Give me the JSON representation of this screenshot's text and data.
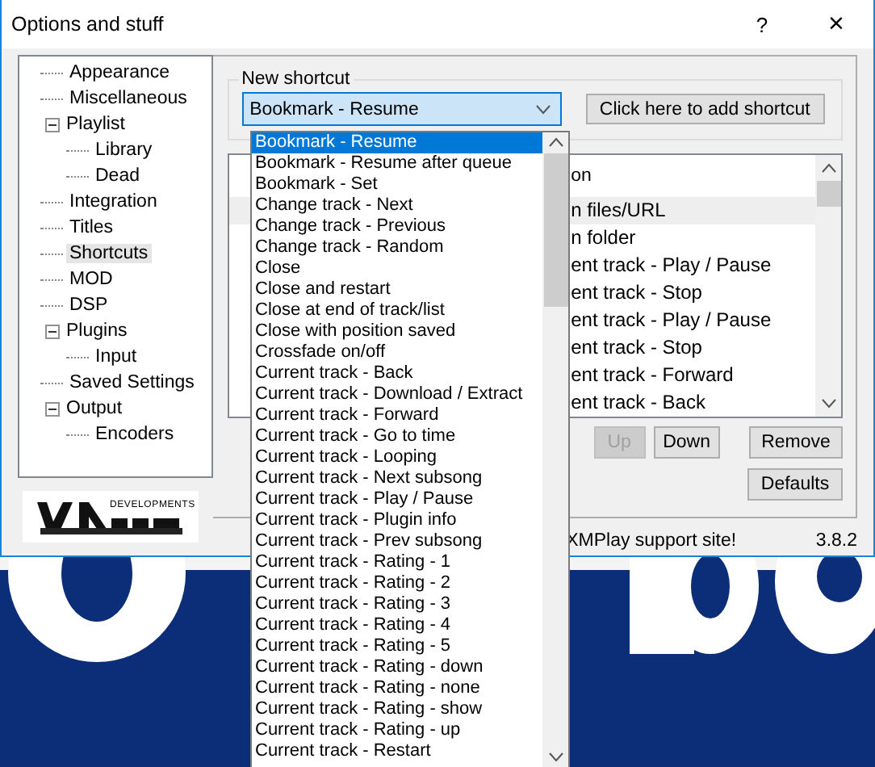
{
  "window": {
    "title": "Options and stuff",
    "help": "?",
    "close": "×"
  },
  "sidebar": {
    "items": [
      {
        "label": "Appearance",
        "selected": false
      },
      {
        "label": "Miscellaneous",
        "selected": false
      },
      {
        "label": "Playlist",
        "selected": false,
        "expanded": true,
        "children": [
          {
            "label": "Library",
            "selected": false
          },
          {
            "label": "Dead",
            "selected": false
          }
        ]
      },
      {
        "label": "Integration",
        "selected": false
      },
      {
        "label": "Titles",
        "selected": false
      },
      {
        "label": "Shortcuts",
        "selected": true
      },
      {
        "label": "MOD",
        "selected": false
      },
      {
        "label": "DSP",
        "selected": false
      },
      {
        "label": "Plugins",
        "selected": false,
        "expanded": true,
        "children": [
          {
            "label": "Input",
            "selected": false
          }
        ]
      },
      {
        "label": "Saved Settings",
        "selected": false
      },
      {
        "label": "Output",
        "selected": false,
        "expanded": true,
        "children": [
          {
            "label": "Encoders",
            "selected": false
          }
        ]
      }
    ]
  },
  "logo": {
    "text": "DEVELOPMENTS"
  },
  "new_shortcut": {
    "legend": "New shortcut",
    "value": "Bookmark - Resume",
    "add_button": "Click here to add shortcut"
  },
  "shortcut_list": {
    "header": "on",
    "rows": [
      {
        "text": "n files/URL",
        "selected": true
      },
      {
        "text": "n folder",
        "selected": false
      },
      {
        "text": "ent track - Play / Pause",
        "selected": false
      },
      {
        "text": "ent track - Stop",
        "selected": false
      },
      {
        "text": "ent track - Play / Pause",
        "selected": false
      },
      {
        "text": "ent track - Stop",
        "selected": false
      },
      {
        "text": "ent track - Forward",
        "selected": false
      },
      {
        "text": "ent track - Back",
        "selected": false
      }
    ]
  },
  "buttons": [
    {
      "label": "Up",
      "disabled": true
    },
    {
      "label": "Down",
      "disabled": false
    },
    {
      "label": "Remove",
      "disabled": false
    }
  ],
  "defaults_button": "Defaults",
  "support_link": "XMPlay support site!",
  "version": "3.8.2",
  "dropdown": {
    "items": [
      {
        "label": "Bookmark - Resume",
        "selected": true
      },
      {
        "label": "Bookmark - Resume after queue",
        "selected": false
      },
      {
        "label": "Bookmark - Set",
        "selected": false
      },
      {
        "label": "Change track - Next",
        "selected": false
      },
      {
        "label": "Change track - Previous",
        "selected": false
      },
      {
        "label": "Change track - Random",
        "selected": false
      },
      {
        "label": "Close",
        "selected": false
      },
      {
        "label": "Close and restart",
        "selected": false
      },
      {
        "label": "Close at end of track/list",
        "selected": false
      },
      {
        "label": "Close with position saved",
        "selected": false
      },
      {
        "label": "Crossfade on/off",
        "selected": false
      },
      {
        "label": "Current track - Back",
        "selected": false
      },
      {
        "label": "Current track - Download / Extract",
        "selected": false
      },
      {
        "label": "Current track - Forward",
        "selected": false
      },
      {
        "label": "Current track - Go to time",
        "selected": false
      },
      {
        "label": "Current track - Looping",
        "selected": false
      },
      {
        "label": "Current track - Next subsong",
        "selected": false
      },
      {
        "label": "Current track - Play / Pause",
        "selected": false
      },
      {
        "label": "Current track - Plugin info",
        "selected": false
      },
      {
        "label": "Current track - Prev subsong",
        "selected": false
      },
      {
        "label": "Current track - Rating - 1",
        "selected": false
      },
      {
        "label": "Current track - Rating - 2",
        "selected": false
      },
      {
        "label": "Current track - Rating - 3",
        "selected": false
      },
      {
        "label": "Current track - Rating - 4",
        "selected": false
      },
      {
        "label": "Current track - Rating - 5",
        "selected": false
      },
      {
        "label": "Current track - Rating - down",
        "selected": false
      },
      {
        "label": "Current track - Rating - none",
        "selected": false
      },
      {
        "label": "Current track - Rating - show",
        "selected": false
      },
      {
        "label": "Current track - Rating - up",
        "selected": false
      },
      {
        "label": "Current track - Restart",
        "selected": false
      }
    ]
  }
}
